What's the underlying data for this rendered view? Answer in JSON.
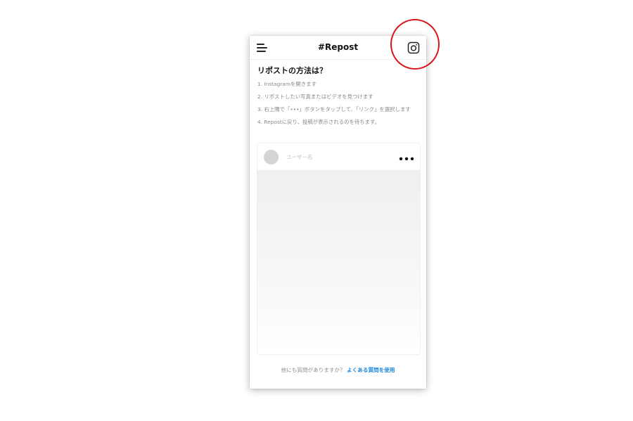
{
  "header": {
    "title": "#Repost",
    "menu_icon": "hamburger-menu-icon",
    "instagram_icon": "instagram-icon"
  },
  "help": {
    "title": "リポストの方法は？",
    "steps": [
      "1. Instagramを開きます",
      "2. リポストしたい写真またはビデオを見つけます",
      "3. 右上隅で「•••」ボタンをタップして、「リンク」を選択します",
      "4. Repostに戻り、投稿が表示されるのを待ちます。"
    ]
  },
  "post_card": {
    "username_placeholder": "ユーザー名",
    "more_icon": "more-horizontal-icon"
  },
  "footer": {
    "question": "他にも質問がありますか？",
    "faq_link": "よくある質問を使用"
  },
  "colors": {
    "link": "#1b86d9",
    "annotation": "#d9161c"
  }
}
